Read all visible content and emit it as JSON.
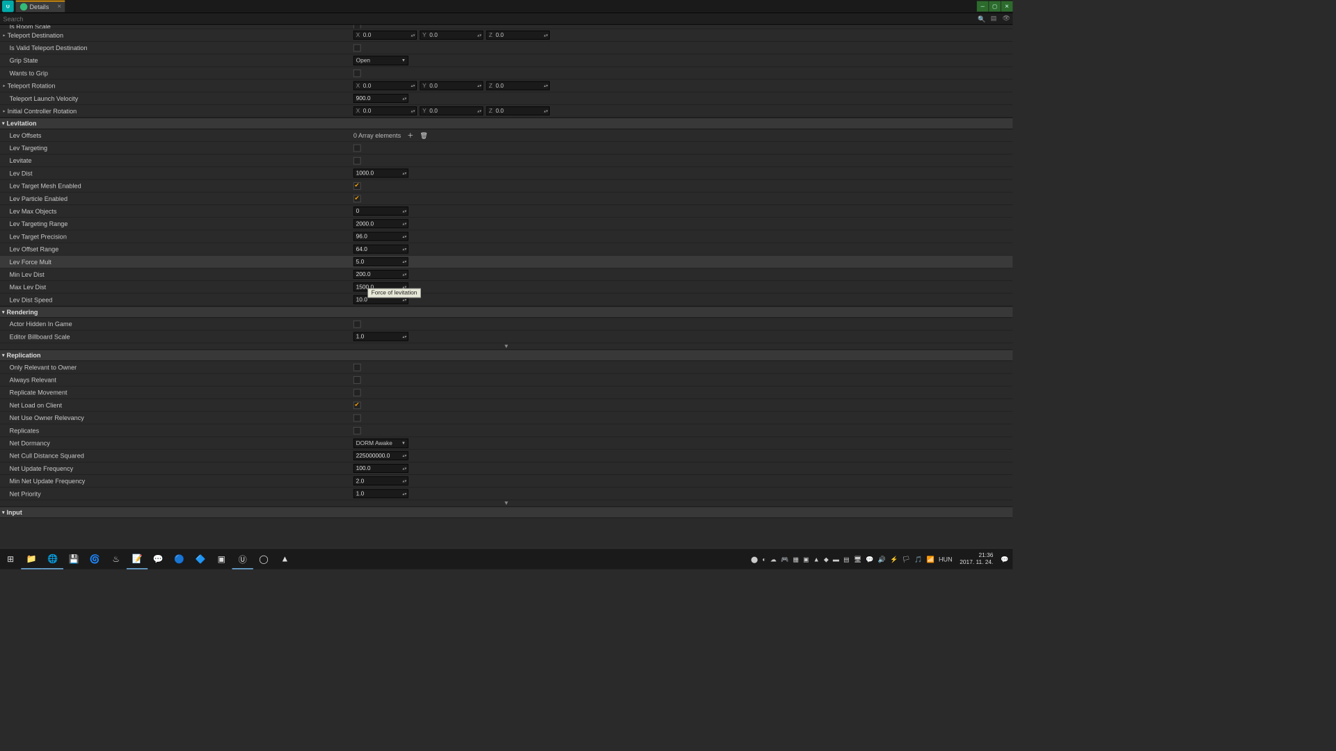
{
  "tab_title": "Details",
  "search_placeholder": "Search",
  "tooltip_text": "Force of levitation",
  "top_props": [
    {
      "label": "Is Room Scale",
      "type": "cut"
    },
    {
      "label": "Teleport Destination",
      "type": "vec",
      "expandable": true,
      "x": "0.0",
      "y": "0.0",
      "z": "0.0"
    },
    {
      "label": "Is Valid Teleport Destination",
      "type": "chk",
      "on": false
    },
    {
      "label": "Grip State",
      "type": "dd",
      "val": "Open"
    },
    {
      "label": "Wants to Grip",
      "type": "chk",
      "on": false
    },
    {
      "label": "Teleport Rotation",
      "type": "vec",
      "expandable": true,
      "x": "0.0",
      "y": "0.0",
      "z": "0.0"
    },
    {
      "label": "Teleport Launch Velocity",
      "type": "num",
      "val": "900.0"
    },
    {
      "label": "Initial Controller Rotation",
      "type": "vec",
      "expandable": true,
      "x": "0.0",
      "y": "0.0",
      "z": "0.0"
    }
  ],
  "sections": [
    {
      "title": "Levitation",
      "props": [
        {
          "label": "Lev Offsets",
          "type": "arr",
          "val": "0 Array elements"
        },
        {
          "label": "Lev Targeting",
          "type": "chk",
          "on": false
        },
        {
          "label": "Levitate",
          "type": "chk",
          "on": false
        },
        {
          "label": "Lev Dist",
          "type": "num",
          "val": "1000.0"
        },
        {
          "label": "Lev Target Mesh Enabled",
          "type": "chk",
          "on": true
        },
        {
          "label": "Lev Particle Enabled",
          "type": "chk",
          "on": true
        },
        {
          "label": "Lev Max Objects",
          "type": "num",
          "val": "0"
        },
        {
          "label": "Lev Targeting Range",
          "type": "num",
          "val": "2000.0"
        },
        {
          "label": "Lev Target Precision",
          "type": "num",
          "val": "96.0"
        },
        {
          "label": "Lev Offset Range",
          "type": "num",
          "val": "64.0"
        },
        {
          "label": "Lev Force Mult",
          "type": "num",
          "val": "5.0",
          "hover": true
        },
        {
          "label": "Min Lev Dist",
          "type": "num",
          "val": "200.0",
          "obscured": true
        },
        {
          "label": "Max Lev Dist",
          "type": "num",
          "val": "1500.0"
        },
        {
          "label": "Lev Dist Speed",
          "type": "num",
          "val": "10.0"
        }
      ]
    },
    {
      "title": "Rendering",
      "props": [
        {
          "label": "Actor Hidden In Game",
          "type": "chk",
          "on": false
        },
        {
          "label": "Editor Billboard Scale",
          "type": "num",
          "val": "1.0"
        }
      ],
      "chevron": true
    },
    {
      "title": "Replication",
      "props": [
        {
          "label": "Only Relevant to Owner",
          "type": "chk",
          "on": false
        },
        {
          "label": "Always Relevant",
          "type": "chk",
          "on": false
        },
        {
          "label": "Replicate Movement",
          "type": "chk",
          "on": false
        },
        {
          "label": "Net Load on Client",
          "type": "chk",
          "on": true
        },
        {
          "label": "Net Use Owner Relevancy",
          "type": "chk",
          "on": false
        },
        {
          "label": "Replicates",
          "type": "chk",
          "on": false
        },
        {
          "label": "Net Dormancy",
          "type": "dd",
          "val": "DORM Awake"
        },
        {
          "label": "Net Cull Distance Squared",
          "type": "num",
          "val": "225000000.0"
        },
        {
          "label": "Net Update Frequency",
          "type": "num",
          "val": "100.0"
        },
        {
          "label": "Min Net Update Frequency",
          "type": "num",
          "val": "2.0"
        },
        {
          "label": "Net Priority",
          "type": "num",
          "val": "1.0"
        }
      ],
      "chevron": true
    },
    {
      "title": "Input",
      "props": []
    }
  ],
  "taskbar": {
    "lang": "HUN",
    "time": "21:36",
    "date": "2017. 11. 24."
  }
}
